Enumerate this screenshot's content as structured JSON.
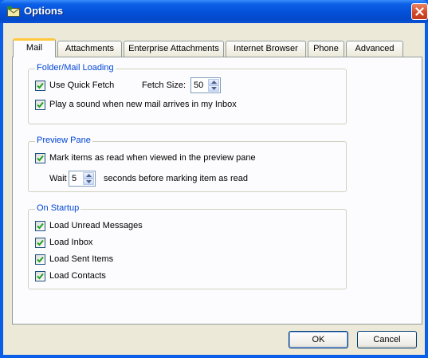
{
  "window": {
    "title": "Options"
  },
  "tabs": [
    {
      "label": "Mail",
      "active": true
    },
    {
      "label": "Attachments"
    },
    {
      "label": "Enterprise Attachments"
    },
    {
      "label": "Internet Browser"
    },
    {
      "label": "Phone"
    },
    {
      "label": "Advanced"
    }
  ],
  "folder_mail_loading": {
    "legend": "Folder/Mail Loading",
    "quick_fetch": {
      "label": "Use Quick Fetch",
      "checked": true
    },
    "fetch_size": {
      "label": "Fetch Size:",
      "value": "50"
    },
    "play_sound": {
      "label": "Play a sound when new mail arrives in my Inbox",
      "checked": true
    }
  },
  "preview_pane": {
    "legend": "Preview Pane",
    "mark_read": {
      "label": "Mark items as read when viewed in the preview pane",
      "checked": true
    },
    "wait_prefix": "Wait",
    "wait_value": "5",
    "wait_suffix": "seconds before marking item as read"
  },
  "on_startup": {
    "legend": "On Startup",
    "items": [
      {
        "label": "Load Unread Messages",
        "checked": true
      },
      {
        "label": "Load Inbox",
        "checked": true
      },
      {
        "label": "Load Sent Items",
        "checked": true
      },
      {
        "label": "Load Contacts",
        "checked": true
      }
    ]
  },
  "buttons": {
    "ok": "OK",
    "cancel": "Cancel"
  },
  "colors": {
    "title_bar": "#0450d8",
    "dialog_face": "#ece9d8",
    "group_legend": "#0046d5",
    "check_mark": "#21a121",
    "close_button": "#d5482a",
    "active_tab_highlight": "#ffc83c"
  }
}
